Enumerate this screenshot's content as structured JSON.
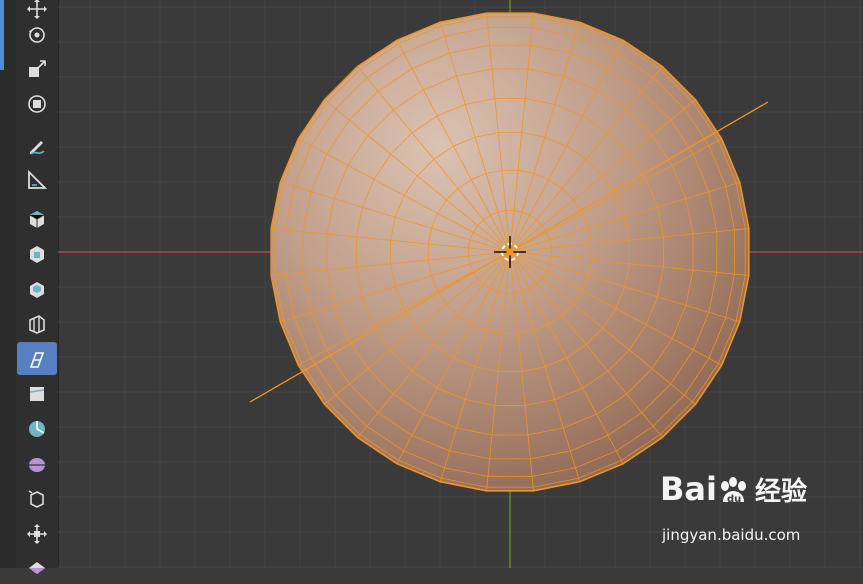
{
  "toolbar": {
    "items": [
      {
        "icon": "move-icon",
        "active": false
      },
      {
        "icon": "rotate-icon",
        "active": false
      },
      {
        "icon": "scale-icon",
        "active": false
      },
      {
        "icon": "transform-icon",
        "active": false
      },
      {
        "icon": "annotate-icon",
        "active": false
      },
      {
        "icon": "measure-icon",
        "active": false
      },
      {
        "icon": "add-cube-icon",
        "active": false
      },
      {
        "icon": "extrude-region-icon",
        "active": false
      },
      {
        "icon": "inset-faces-icon",
        "active": false
      },
      {
        "icon": "bevel-icon",
        "active": false
      },
      {
        "icon": "loop-cut-icon",
        "active": true
      },
      {
        "icon": "knife-icon",
        "active": false
      },
      {
        "icon": "poly-build-icon",
        "active": false
      },
      {
        "icon": "spin-icon",
        "active": false
      },
      {
        "icon": "smooth-icon",
        "active": false
      },
      {
        "icon": "shrink-fatten-icon",
        "active": false
      },
      {
        "icon": "shear-icon",
        "active": false
      }
    ],
    "accent_color": "#5680c2"
  },
  "viewport": {
    "background_color": "#3a3a3a",
    "grid_color": "#444444",
    "x_axis_color": "#c8464b",
    "y_axis_color": "#6e9c2e",
    "mesh": {
      "object": "uv-sphere",
      "view": "top",
      "fill_color": "#c39a80",
      "edge_color": "#f39422",
      "rings": 9,
      "segments": 32
    }
  },
  "watermark": {
    "brand": "Bai",
    "brand_suffix": "du",
    "product": "经验",
    "url": "jingyan.baidu.com"
  }
}
